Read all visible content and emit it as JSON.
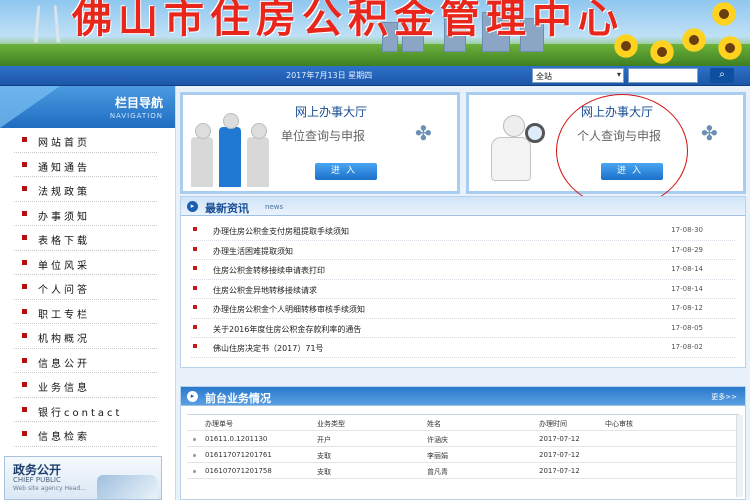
{
  "banner": {
    "title": "佛山市住房公积金管理中心"
  },
  "datebar": {
    "date": "2017年7月13日 星期四",
    "scope_selected": "全站",
    "search_placeholder": "",
    "search_icon": "search-icon"
  },
  "leftnav": {
    "title": "栏目导航",
    "subtitle": "NAVIGATION",
    "items": [
      {
        "label": "网站首页"
      },
      {
        "label": "通知通告"
      },
      {
        "label": "法规政策"
      },
      {
        "label": "办事须知"
      },
      {
        "label": "表格下载"
      },
      {
        "label": "单位风采"
      },
      {
        "label": "个人问答"
      },
      {
        "label": "职工专栏"
      },
      {
        "label": "机构概况"
      },
      {
        "label": "信息公开"
      },
      {
        "label": "业务信息"
      },
      {
        "label": "银行contact"
      },
      {
        "label": "信息检索"
      }
    ],
    "gov": {
      "title": "政务公开",
      "line1": "CHIEF PUBLIC",
      "line2": "Web site agency Head..."
    }
  },
  "halls": {
    "unit": {
      "title": "网上办事大厅",
      "subtitle": "单位查询与申报",
      "enter": "进入"
    },
    "person": {
      "title": "网上办事大厅",
      "subtitle": "个人查询与申报",
      "enter": "进入"
    }
  },
  "news": {
    "title": "最新资讯",
    "title_en": "news",
    "items": [
      {
        "text": "办理住房公积金支付房租提取手续须知",
        "date": "17-08-30"
      },
      {
        "text": "办理生活困难提取须知",
        "date": "17-08-29"
      },
      {
        "text": "住房公积金转移接续申请表打印",
        "date": "17-08-14"
      },
      {
        "text": "住房公积金异地转移接续请求",
        "date": "17-08-14"
      },
      {
        "text": "办理住房公积金个人明细转移审核手续须知",
        "date": "17-08-12"
      },
      {
        "text": "关于2016年度住房公积金存款利率的通告",
        "date": "17-08-05"
      },
      {
        "text": "佛山住房决定书（2017）71号",
        "date": "17-08-02"
      }
    ]
  },
  "business": {
    "title": "前台业务情况",
    "more": "更多>>",
    "headers": [
      "办理单号",
      "业务类型",
      "姓名",
      "办理时间",
      "中心审核"
    ],
    "rows": [
      {
        "id": "01611.0.1201130",
        "type": "开户",
        "name": "许涵庆",
        "time": "2017-07-12"
      },
      {
        "id": "016117071201761",
        "type": "支取",
        "name": "李丽娟",
        "time": "2017-07-12"
      },
      {
        "id": "016107071201758",
        "type": "支取",
        "name": "曾凡青",
        "time": "2017-07-12"
      }
    ]
  }
}
